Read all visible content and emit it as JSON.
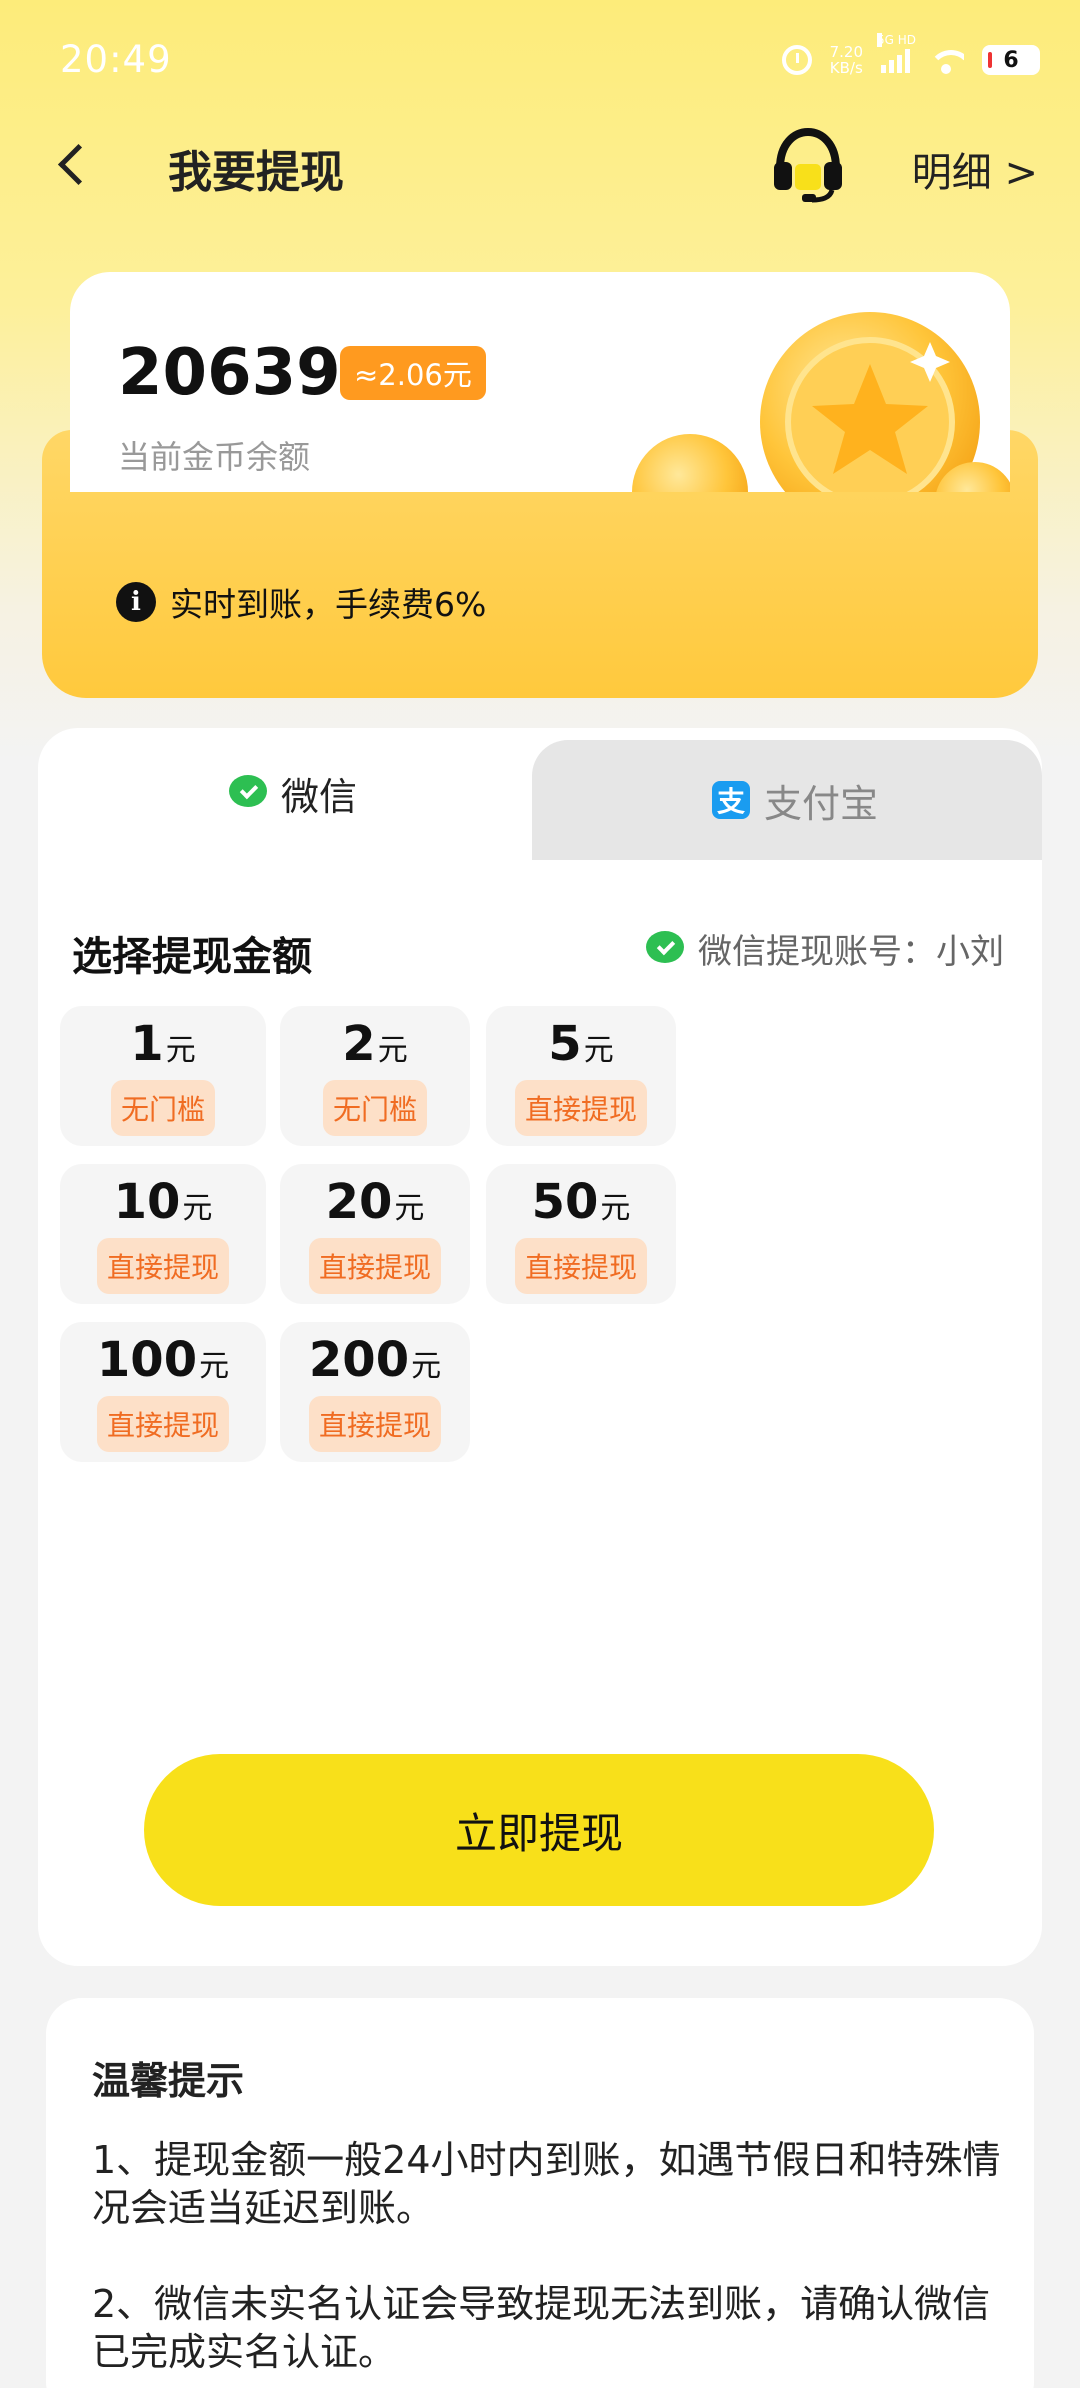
{
  "status_bar": {
    "time": "20:49",
    "net_speed_top": "7.20",
    "net_speed_bottom": "KB/s",
    "signal_label": "5G HD",
    "battery": "6"
  },
  "header": {
    "title": "我要提现",
    "detail_link": "明细 >"
  },
  "balance": {
    "amount": "20639",
    "approx": "≈2.06元",
    "label": "当前金币余额",
    "notice_icon": "i",
    "notice": "实时到账，手续费6%"
  },
  "tabs": {
    "wechat": "微信",
    "alipay": "支付宝",
    "alipay_icon": "支"
  },
  "section": {
    "title": "选择提现金额",
    "account": "微信提现账号：小刘"
  },
  "amounts": [
    {
      "value": "1",
      "unit": "元",
      "tag": "无门槛"
    },
    {
      "value": "2",
      "unit": "元",
      "tag": "无门槛"
    },
    {
      "value": "5",
      "unit": "元",
      "tag": "直接提现"
    },
    {
      "value": "10",
      "unit": "元",
      "tag": "直接提现"
    },
    {
      "value": "20",
      "unit": "元",
      "tag": "直接提现"
    },
    {
      "value": "50",
      "unit": "元",
      "tag": "直接提现"
    },
    {
      "value": "100",
      "unit": "元",
      "tag": "直接提现"
    },
    {
      "value": "200",
      "unit": "元",
      "tag": "直接提现"
    }
  ],
  "withdraw_button": "立即提现",
  "tips": {
    "title": "温馨提示",
    "items": [
      "1、提现金额一般24小时内到账，如遇节假日和特殊情况会适当延迟到账。",
      " 2、微信未实名认证会导致提现无法到账，请确认微信已完成实名认证。"
    ]
  },
  "colors": {
    "accent_yellow": "#f8e01a",
    "tag_orange": "#f06c22",
    "approx_badge": "#ff9a1f",
    "wechat_green": "#2dbf52",
    "alipay_blue": "#1a9cf0"
  }
}
